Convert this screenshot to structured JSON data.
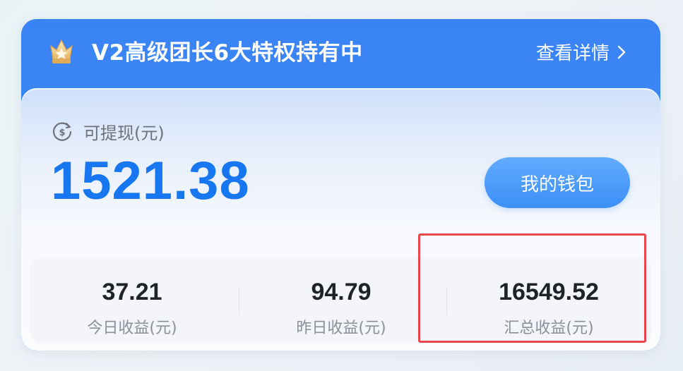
{
  "header": {
    "title": "V2高级团长6大特权持有中",
    "link_label": "查看详情"
  },
  "withdrawable": {
    "label": "可提现(元)",
    "amount": "1521.38"
  },
  "wallet_button": {
    "label": "我的钱包"
  },
  "stats": [
    {
      "value": "37.21",
      "label": "今日收益(元)"
    },
    {
      "value": "94.79",
      "label": "昨日收益(元)"
    },
    {
      "value": "16549.52",
      "label": "汇总收益(元)"
    }
  ],
  "icons": {
    "badge": "crown-badge-icon",
    "link": "chevron-right-icon",
    "withdraw": "coin-withdraw-icon"
  },
  "colors": {
    "header_blue": "#3a83f5",
    "amount_blue": "#1677f0",
    "button_blue": "#3b8ff6",
    "highlight_red": "#e8474c"
  }
}
